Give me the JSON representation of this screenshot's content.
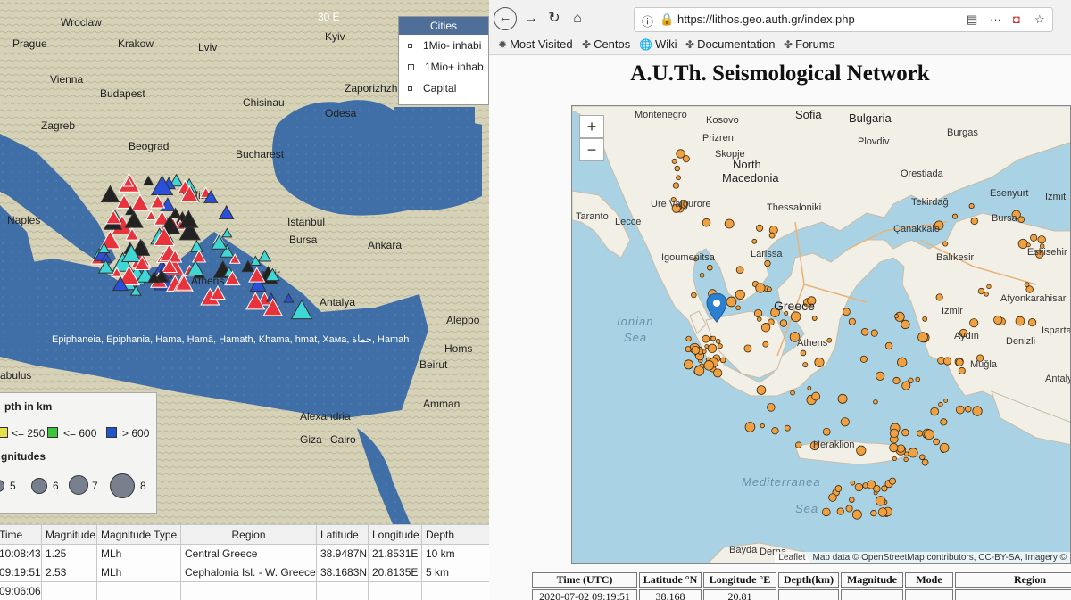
{
  "left_window": {
    "map_labels": {
      "cities": [
        "Wroclaw",
        "Krakow",
        "Lviv",
        "Kyiv",
        "Prague",
        "Vienna",
        "Budapest",
        "Chisinau",
        "Zaporizhzh",
        "Zagreb",
        "Beograd",
        "Odesa",
        "Bucharest",
        "Sofia",
        "Naples",
        "Istanbul",
        "Bursa",
        "Ankara",
        "Izmir",
        "Athens",
        "Antalya",
        "Aleppo",
        "Homs",
        "Beirut",
        "Amman",
        "Alexandria",
        "Giza",
        "Cairo",
        "abulus"
      ],
      "grid_label": "30 E",
      "place_strip": "Epiphaneia, Epiphania, Hama, Ḥamā, Ḥamath, Khama, hmat, Хама, حماة, Hamah"
    },
    "cities_box": {
      "title": "Cities",
      "rows": [
        "1Mio- inhabi",
        "1Mio+ inhab",
        "Capital"
      ]
    },
    "legend": {
      "depth_title": "pth in km",
      "depth_items": [
        {
          "label": "<= 250",
          "color": "#e8e04a"
        },
        {
          "label": "<= 600",
          "color": "#3cc43c"
        },
        {
          "label": "> 600",
          "color": "#2255cc"
        }
      ],
      "mag_title": "gnitudes",
      "mag_items": [
        "5",
        "6",
        "7",
        "8"
      ]
    },
    "table": {
      "headers": [
        "Time",
        "Magnitude",
        "Magnitude Type",
        "Region",
        "Latitude",
        "Longitude",
        "Depth"
      ],
      "rows": [
        [
          "10:08:43",
          "1.25",
          "MLh",
          "Central Greece",
          "38.9487N",
          "21.8531E",
          "10 km"
        ],
        [
          "09:19:51",
          "2.53",
          "MLh",
          "Cephalonia Isl. - W. Greece",
          "38.1683N",
          "20.8135E",
          "5 km"
        ],
        [
          "09:06:06",
          "",
          "",
          "",
          "",
          "",
          ""
        ]
      ]
    }
  },
  "browser": {
    "url": "https://lithos.geo.auth.gr/index.php",
    "bookmarks": [
      {
        "label": "Most Visited",
        "icon": "gear-icon"
      },
      {
        "label": "Centos",
        "icon": "centos-icon"
      },
      {
        "label": "Wiki",
        "icon": "globe-icon"
      },
      {
        "label": "Documentation",
        "icon": "doc-icon"
      },
      {
        "label": "Forums",
        "icon": "forum-icon"
      }
    ],
    "page_title": "A.U.Th. Seismological Network",
    "map": {
      "zoom_in": "+",
      "zoom_out": "−",
      "labels": [
        "Montenegro",
        "Kosovo",
        "Sofia",
        "Bulgaria",
        "Prizren",
        "Plovdiv",
        "Skopje",
        "Burgas",
        "North",
        "Macedonia",
        "Orestiada",
        "Tekirdağ",
        "Esenyurt",
        "Izmit",
        "Taranto",
        "Lecce",
        "Ure Vajgurore",
        "Thessaloniki",
        "Bursa",
        "Çanakkale",
        "Eskisehir",
        "Igoumenitsa",
        "Larissa",
        "Balıkesir",
        "Greece",
        "Izmir",
        "Afyonkarahisar",
        "Athens",
        "Aydın",
        "Denizli",
        "Muğla",
        "Heraklion",
        "Bayda",
        "Derna",
        "Isparta",
        "Antalya"
      ],
      "sea_labels": [
        "Ionian",
        "Sea",
        "Mediterranea",
        "Sea"
      ],
      "attribution": "Leaflet | Map data © OpenStreetMap contributors, CC-BY-SA, Imagery ©"
    },
    "table": {
      "headers": [
        "Time (UTC)",
        "Latitude °N",
        "Longitude °E",
        "Depth(km)",
        "Magnitude",
        "Mode",
        "Region"
      ],
      "first_row": [
        "2020-07-02 09:19:51",
        "38.168",
        "20.81",
        "",
        "",
        "",
        ""
      ]
    }
  },
  "colors": {
    "event_red": "#e8323c",
    "event_cyan": "#3fd6d6",
    "event_blue": "#2a4fd8",
    "event_dark": "#222222",
    "quake_dot": "#f0a040",
    "sea_left": "#3d6ea6",
    "sea_right": "#a9d3e4"
  }
}
